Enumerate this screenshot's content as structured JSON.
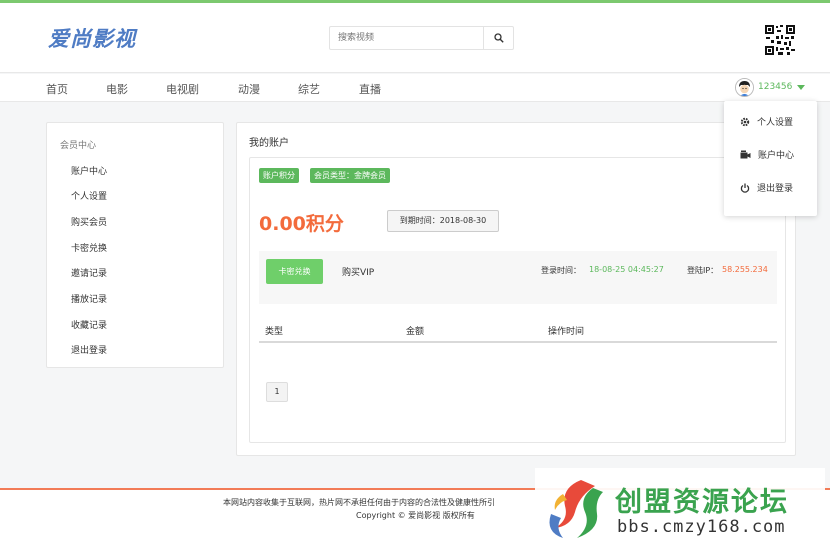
{
  "header": {
    "logo": "爱尚影视",
    "search_placeholder": "搜索视频"
  },
  "nav": {
    "items": [
      "首页",
      "电影",
      "电视剧",
      "动漫",
      "综艺",
      "直播"
    ]
  },
  "user": {
    "name": "123456",
    "menu": [
      "个人设置",
      "账户中心",
      "退出登录"
    ]
  },
  "sidebar": {
    "title": "会员中心",
    "items": [
      "账户中心",
      "个人设置",
      "购买会员",
      "卡密兑换",
      "邀请记录",
      "播放记录",
      "收藏记录",
      "退出登录"
    ]
  },
  "account": {
    "title": "我的账户",
    "badge_points": "账户积分",
    "badge_member": "会员类型：金牌会员",
    "points": "0.00积分",
    "expire": "到期时间：2018-08-30",
    "card_button": "卡密兑换",
    "buy_vip": "购买VIP",
    "login_time_label": "登录时间：",
    "login_time": "18-08-25 04:45:27",
    "login_ip_label": "登陆IP：",
    "login_ip": "58.255.234",
    "table_headers": [
      "类型",
      "金额",
      "操作时间"
    ],
    "page": "1"
  },
  "footer": {
    "line1": "本网站内容收集于互联网，热片网不承担任何由于内容的合法性及健康性所引",
    "line2": "Copyright ©  爱尚影视 版权所有"
  },
  "watermark": {
    "text": "创盟资源论坛",
    "url": "bbs.cmzy168.com"
  },
  "colors": {
    "accent": "#5cb85c",
    "points": "#f36b3c",
    "logo": "#4f7cc4"
  }
}
